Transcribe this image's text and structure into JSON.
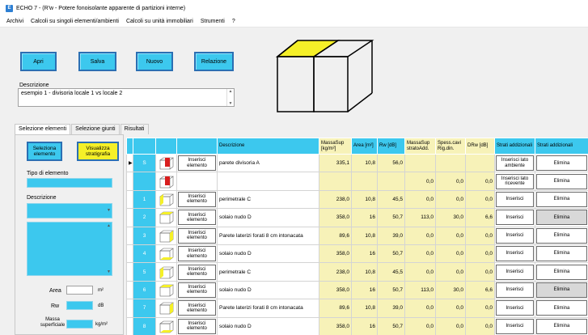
{
  "window": {
    "title": "ECHO 7 - (R'w - Potere fonoisolante apparente di partizioni interne)"
  },
  "menu": [
    "Archivi",
    "Calcoli su singoli elementi/ambienti",
    "Calcoli su unità immobiliari",
    "Strumenti",
    "?"
  ],
  "toolbar": {
    "open": "Apri",
    "save": "Salva",
    "new": "Nuovo",
    "report": "Relazione"
  },
  "description": {
    "label": "Descrizione",
    "value": "esempio 1 - divisoria locale 1 vs locale 2"
  },
  "tabs": [
    "Selezione elementi",
    "Selezione giunti",
    "Risultati"
  ],
  "left": {
    "select_element": "Seleziona elemento",
    "show_stratigraphy": "Visualizza stratigrafia",
    "element_type_label": "Tipo di elemento",
    "description_label": "Descrizione",
    "area_label": "Area",
    "area_unit": "m²",
    "rw_label": "Rw",
    "rw_unit": "dB",
    "mass_label": "Massa superficiale",
    "mass_unit": "kg/m²"
  },
  "table": {
    "headers": [
      "Descrizione",
      "MassaSup [kg/m²]",
      "Area [m²]",
      "Rw [dB]",
      "MassaSup stratoAdd.",
      "Spess.cavi Rig.din.",
      "DRw [dB]",
      "Strati addizionali",
      "Strati addizionali"
    ],
    "rows": [
      {
        "num": "S",
        "selected": true,
        "icon": "red",
        "insert": "Inserisci elemento",
        "desc": "parete divisoria A",
        "mass": "335,1",
        "area": "10,8",
        "rw": "56,0",
        "madd": "",
        "spess": "",
        "drw": "",
        "strati": "",
        "elimina": ""
      },
      {
        "num": "",
        "selected": false,
        "icon": "red2",
        "insert": "",
        "desc": "",
        "mass": "",
        "area": "",
        "rw": "",
        "madd": "0,0",
        "spess": "0,0",
        "drw": "0,0",
        "strati": "Inserisci lato ricevente",
        "elimina": "Elimina"
      },
      {
        "num": "1",
        "selected": false,
        "icon": "yellow-left",
        "insert": "Inserisci elemento",
        "desc": "perimetrale C",
        "mass": "238,0",
        "area": "10,8",
        "rw": "45,5",
        "madd": "0,0",
        "spess": "0,0",
        "drw": "0,0",
        "strati": "Inserisci",
        "elimina": "Elimina"
      },
      {
        "num": "2",
        "selected": false,
        "icon": "yellow-top",
        "insert": "Inserisci elemento",
        "desc": "solaio nudo D",
        "mass": "358,0",
        "area": "16",
        "rw": "50,7",
        "madd": "113,0",
        "spess": "30,0",
        "drw": "6,6",
        "strati": "Inserisci",
        "elimina": "Elimina"
      },
      {
        "num": "3",
        "selected": false,
        "icon": "yellow-right",
        "insert": "Inserisci elemento",
        "desc": "Parete laterizi forati 8 cm intonacata",
        "mass": "89,6",
        "area": "10,8",
        "rw": "39,0",
        "madd": "0,0",
        "spess": "0,0",
        "drw": "0,0",
        "strati": "Inserisci",
        "elimina": "Elimina"
      },
      {
        "num": "4",
        "selected": false,
        "icon": "yellow-bottom",
        "insert": "Inserisci elemento",
        "desc": "solaio nudo D",
        "mass": "358,0",
        "area": "16",
        "rw": "50,7",
        "madd": "0,0",
        "spess": "0,0",
        "drw": "0,0",
        "strati": "Inserisci",
        "elimina": "Elimina"
      },
      {
        "num": "5",
        "selected": false,
        "icon": "yellow-left",
        "insert": "Inserisci elemento",
        "desc": "perimetrale C",
        "mass": "238,0",
        "area": "10,8",
        "rw": "45,5",
        "madd": "0,0",
        "spess": "0,0",
        "drw": "0,0",
        "strati": "Inserisci",
        "elimina": "Elimina"
      },
      {
        "num": "6",
        "selected": false,
        "icon": "yellow-top",
        "insert": "Inserisci elemento",
        "desc": "solaio nudo D",
        "mass": "358,0",
        "area": "16",
        "rw": "50,7",
        "madd": "113,0",
        "spess": "30,0",
        "drw": "6,6",
        "strati": "Inserisci",
        "elimina": "Elimina"
      },
      {
        "num": "7",
        "selected": false,
        "icon": "yellow-right",
        "insert": "Inserisci elemento",
        "desc": "Parete laterizi forati 8 cm intonacata",
        "mass": "89,6",
        "area": "10,8",
        "rw": "39,0",
        "madd": "0,0",
        "spess": "0,0",
        "drw": "0,0",
        "strati": "Inserisci",
        "elimina": "Elimina"
      },
      {
        "num": "8",
        "selected": false,
        "icon": "yellow-bottom",
        "insert": "Inserisci elemento",
        "desc": "solaio nudo D",
        "mass": "358,0",
        "area": "16",
        "rw": "50,7",
        "madd": "0,0",
        "spess": "0,0",
        "drw": "0,0",
        "strati": "Inserisci",
        "elimina": "Elimina"
      }
    ],
    "row0_strati": "Inserisci lato ambiente",
    "row0_elimina": "Elimina"
  },
  "colors": {
    "accent": "#3cc8ee",
    "pale": "#f7f2b8",
    "highlight_yellow": "#f5f028",
    "red": "#d81e1e"
  }
}
